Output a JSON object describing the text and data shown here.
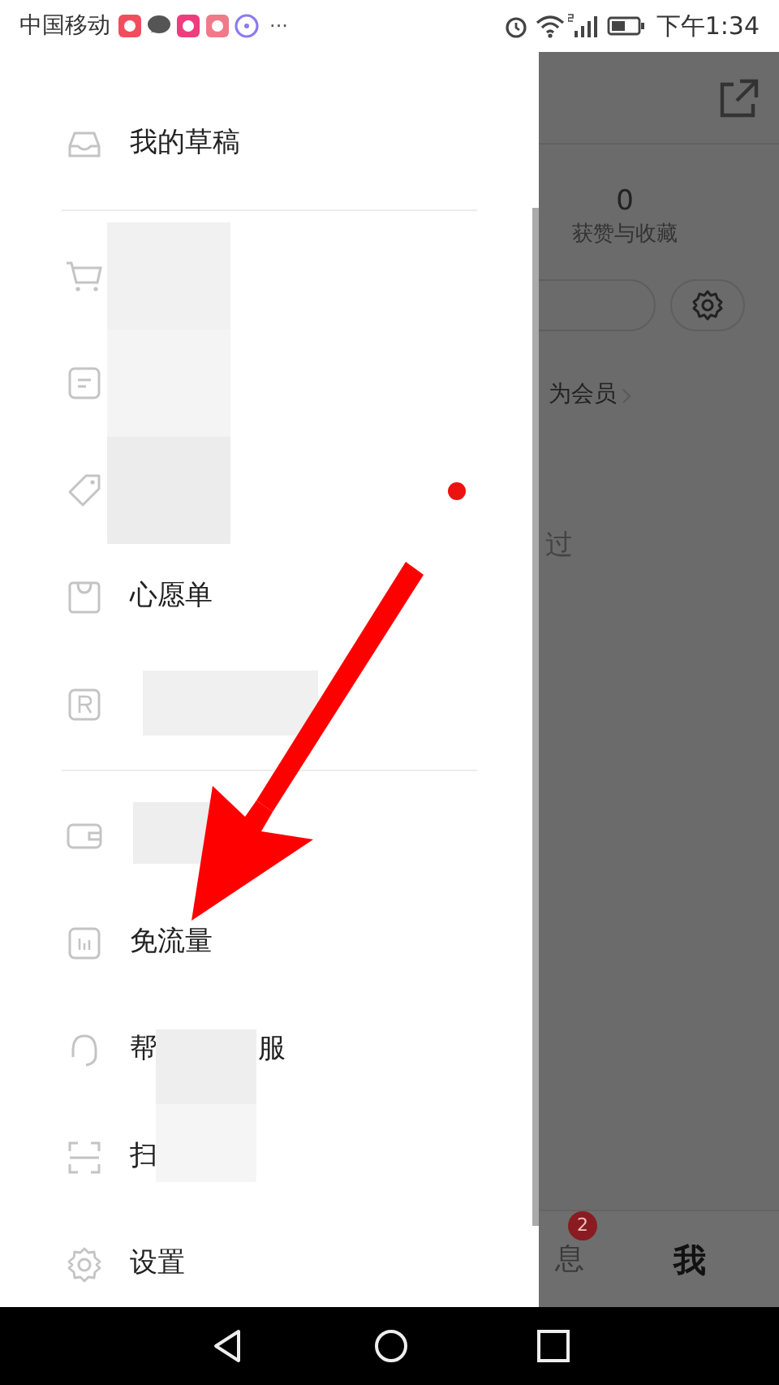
{
  "status_bar": {
    "carrier": "中国移动",
    "more": "···",
    "time": "下午1:34"
  },
  "drawer": {
    "sections": [
      {
        "items": [
          {
            "kind": "inbox",
            "label": "我的草稿"
          }
        ]
      },
      {
        "items": [
          {
            "kind": "cart",
            "redacted": true
          },
          {
            "kind": "document",
            "redacted": true
          },
          {
            "kind": "tag",
            "redacted": true,
            "dot": true
          },
          {
            "kind": "bag",
            "label": "心愿单"
          },
          {
            "kind": "r",
            "redacted": true
          }
        ]
      },
      {
        "items": [
          {
            "kind": "wallet",
            "redacted": true
          },
          {
            "kind": "chart",
            "label": "免流量"
          },
          {
            "kind": "headset",
            "label": "帮",
            "label_end": "服",
            "redacted": true
          },
          {
            "kind": "scan",
            "label": "扫",
            "redacted": true
          },
          {
            "kind": "gear",
            "label": "设置"
          }
        ]
      }
    ]
  },
  "profile": {
    "count": "0",
    "count_label": "获赞与收藏",
    "member_link": "为会员",
    "history_text": "过"
  },
  "tab_bar": [
    {
      "label": "息",
      "badge": "2",
      "selected": false
    },
    {
      "label": "我",
      "selected": true
    }
  ]
}
